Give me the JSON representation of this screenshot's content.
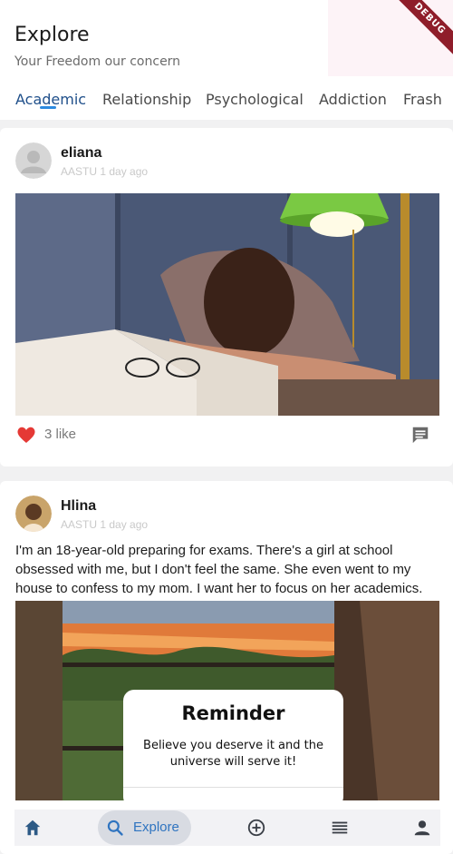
{
  "header": {
    "title": "Explore",
    "subtitle": "Your Freedom our concern",
    "debug_label": "DEBUG"
  },
  "tabs": [
    {
      "label": "Academic",
      "active": true
    },
    {
      "label": "Relationship",
      "active": false
    },
    {
      "label": "Psychological",
      "active": false
    },
    {
      "label": "Addiction",
      "active": false
    },
    {
      "label": "Frash",
      "active": false
    }
  ],
  "posts": [
    {
      "author": "eliana",
      "meta": "AASTU  1 day ago",
      "text": "",
      "likes": "3 like",
      "image": "student-asleep-on-books"
    },
    {
      "author": "Hlina",
      "meta": "AASTU  1 day ago",
      "text": "I'm an 18-year-old preparing for exams. There's a girl at school obsessed with me, but I don't feel the same. She even went to my house to confess to my mom. I want her to focus on her academics. Any advice?",
      "image": "window-sunset-reminder",
      "reminder_title": "Reminder",
      "reminder_body": "Believe you deserve it and the universe will serve it!"
    }
  ],
  "bottom_nav": {
    "items": [
      "home-icon",
      "search-icon",
      "add-circle-icon",
      "list-icon",
      "person-icon"
    ],
    "active_label": "Explore"
  },
  "colors": {
    "accent": "#2c8ae0",
    "like": "#e53935",
    "debug_ribbon": "#8f1d2a"
  }
}
